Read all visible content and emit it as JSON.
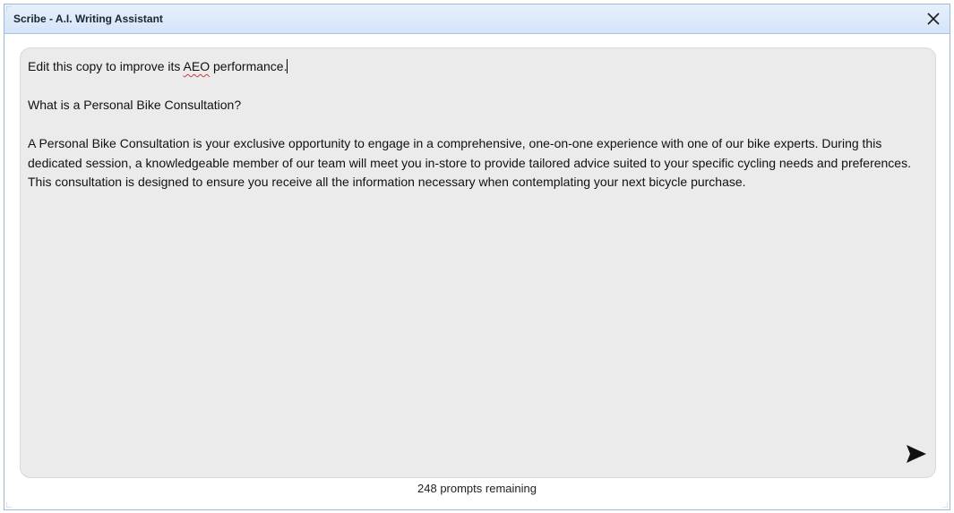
{
  "window": {
    "title": "Scribe - A.I. Writing Assistant",
    "close_icon": "close-icon"
  },
  "editor": {
    "instruction_before": "Edit this copy to improve its ",
    "instruction_flagged_word": "AEO",
    "instruction_after": " performance.",
    "heading": "What is a Personal Bike Consultation?",
    "body": "A Personal Bike Consultation is your exclusive opportunity to engage in a comprehensive, one-on-one experience with one of our bike experts. During this dedicated session, a knowledgeable member of our team will meet you in-store to provide tailored advice suited to your specific cycling needs and preferences. This consultation is designed to ensure you receive all the information necessary when contemplating your next bicycle purchase."
  },
  "send_icon": "send-icon",
  "status": {
    "prompts_remaining": "248 prompts remaining"
  },
  "colors": {
    "titlebar": "#dde8f8",
    "editor_bg": "#ebebeb",
    "spellcheck": "#d23a3a"
  }
}
